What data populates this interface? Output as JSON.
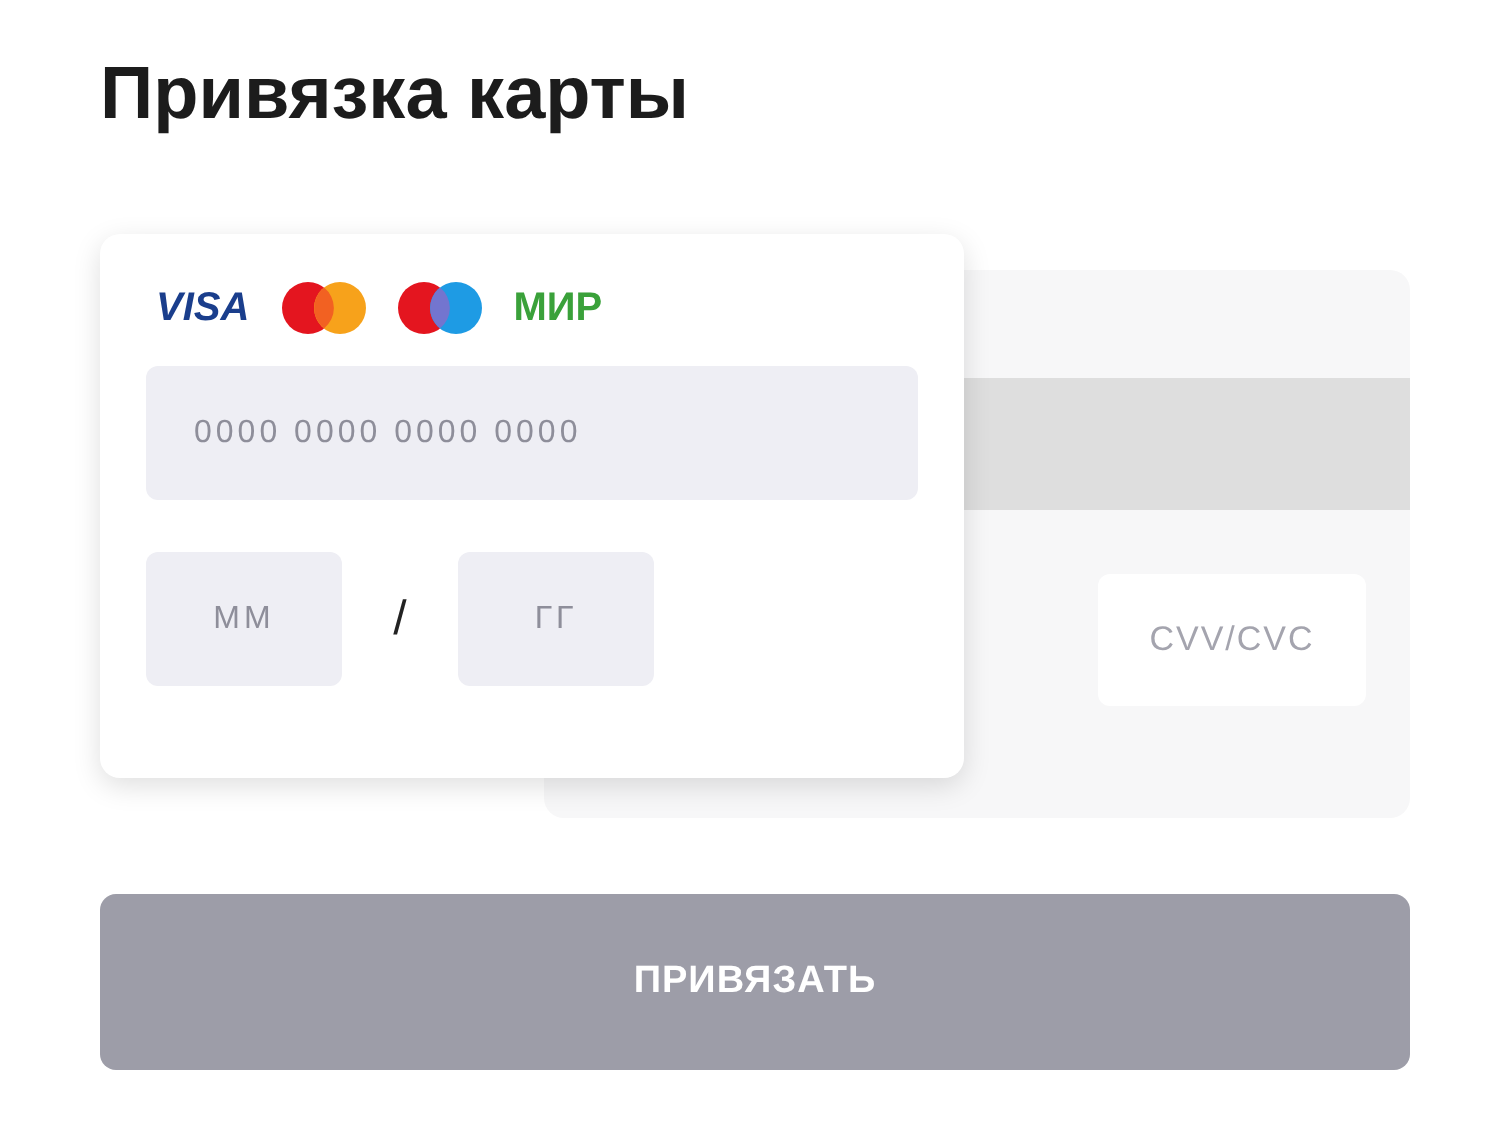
{
  "title": "Привязка карты",
  "brands": [
    {
      "kind": "visa",
      "label": "VISA"
    },
    {
      "kind": "mastercard"
    },
    {
      "kind": "maestro"
    },
    {
      "kind": "mir",
      "label": "МИР"
    }
  ],
  "card_number": {
    "placeholder": "0000 0000 0000 0000"
  },
  "expiry": {
    "month_placeholder": "ММ",
    "separator": "/",
    "year_placeholder": "ГГ"
  },
  "cvv": {
    "placeholder": "CVV/CVC"
  },
  "submit": {
    "label": "ПРИВЯЗАТЬ",
    "disabled": true
  }
}
